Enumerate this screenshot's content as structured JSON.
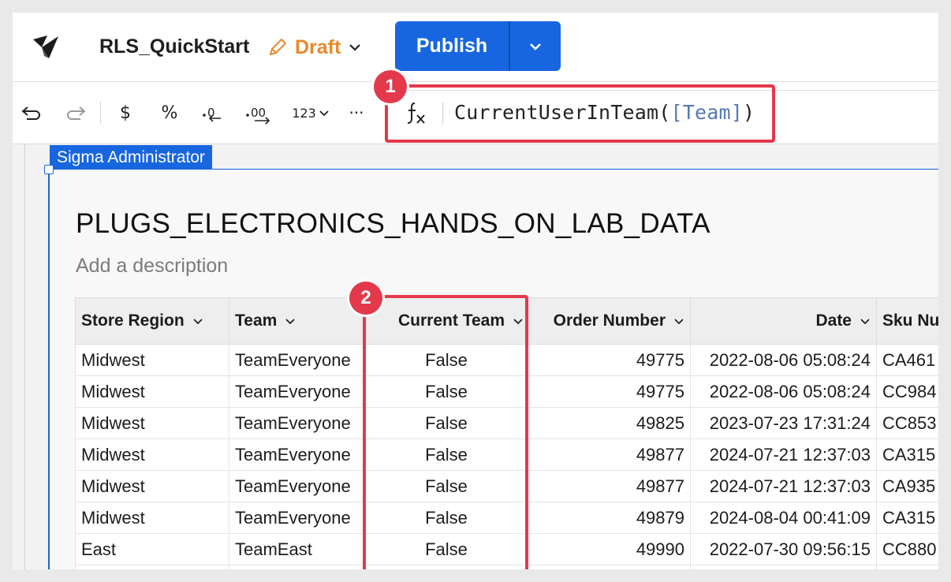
{
  "app": {
    "doc_title": "RLS_QuickStart",
    "status_label": "Draft",
    "publish_label": "Publish"
  },
  "toolbar": {
    "currency_label": "$",
    "percent_label": "%",
    "number_format_label": "123",
    "more_label": "···"
  },
  "formula": {
    "func": "CurrentUserInTeam(",
    "ref": "[Team]",
    "close": ")"
  },
  "element": {
    "selection_label": "Sigma Administrator",
    "title": "PLUGS_ELECTRONICS_HANDS_ON_LAB_DATA",
    "description_placeholder": "Add a description"
  },
  "table": {
    "columns": [
      "Store Region",
      "Team",
      "Current Team",
      "Order Number",
      "Date",
      "Sku Nu"
    ],
    "rows": [
      [
        "Midwest",
        "TeamEveryone",
        "False",
        "49775",
        "2022-08-06 05:08:24",
        "CA461"
      ],
      [
        "Midwest",
        "TeamEveryone",
        "False",
        "49775",
        "2022-08-06 05:08:24",
        "CC984"
      ],
      [
        "Midwest",
        "TeamEveryone",
        "False",
        "49825",
        "2023-07-23 17:31:24",
        "CC853"
      ],
      [
        "Midwest",
        "TeamEveryone",
        "False",
        "49877",
        "2024-07-21 12:37:03",
        "CA315"
      ],
      [
        "Midwest",
        "TeamEveryone",
        "False",
        "49877",
        "2024-07-21 12:37:03",
        "CA935"
      ],
      [
        "Midwest",
        "TeamEveryone",
        "False",
        "49879",
        "2024-08-04 00:41:09",
        "CA315"
      ],
      [
        "East",
        "TeamEast",
        "False",
        "49990",
        "2022-07-30 09:56:15",
        "CC880"
      ],
      [
        "",
        "",
        "",
        "",
        "",
        ""
      ]
    ]
  },
  "annotations": {
    "badge1": "1",
    "badge2": "2"
  },
  "colors": {
    "brand_blue": "#1766e0",
    "draft_orange": "#e8892c",
    "annotation_red": "#e4394b"
  }
}
